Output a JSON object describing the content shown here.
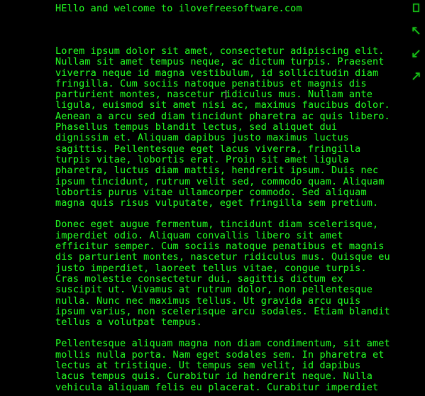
{
  "terminal": {
    "background_color": "#000000",
    "text_color": "#1fe01f",
    "greeting": "HEllo and welcome to ilovefreesoftware.com",
    "paragraphs": [
      {
        "id": "paragraph-1",
        "lines_before_caret": "Lorem ipsum dolor sit amet, consectetur adipiscing elit.\nNullam sit amet tempus neque, ac dictum turpis. Praesent\nviverra neque id magna vestibulum, id sollicitudin diam\nfringilla. Cum sociis natoque penatibus et magnis dis\nparturient montes, nascetur r",
        "lines_after_caret": "idiculus mus. Nullam ante\nligula, euismod sit amet nisi ac, maximus faucibus dolor.\nAenean a arcu sed diam tincidunt pharetra ac quis libero.\nPhasellus tempus blandit lectus, sed aliquet dui\ndignissim et. Aliquam dapibus justo maximus luctus\nsagittis. Pellentesque eget lacus viverra, fringilla\nturpis vitae, lobortis erat. Proin sit amet ligula\npharetra, luctus diam mattis, hendrerit ipsum. Duis nec\nipsum tincidunt, rutrum velit sed, commodo quam. Aliquam\nlobortis purus vitae ullamcorper commodo. Sed aliquam\nmagna quis risus vulputate, eget fringilla sem pretium."
      },
      {
        "id": "paragraph-2",
        "text": "Donec eget augue fermentum, tincidunt diam scelerisque,\nimperdiet odio. Aliquam convallis libero sit amet\nefficitur semper. Cum sociis natoque penatibus et magnis\ndis parturient montes, nascetur ridiculus mus. Quisque eu\njusto imperdiet, laoreet tellus vitae, congue turpis.\nCras molestie consectetur dui, sagittis dictum ex\nsuscipit ut. Vivamus at rutrum dolor, non pellentesque\nnulla. Nunc nec maximus tellus. Ut gravida arcu quis\nipsum varius, non scelerisque arcu sodales. Etiam blandit\ntellus a volutpat tempus."
      },
      {
        "id": "paragraph-3",
        "text": "Pellentesque aliquam magna non diam condimentum, sit amet\nmollis nulla porta. Nam eget sodales sem. In pharetra et\nlectus at tristique. Ut tempus sem velit, id dapibus\nlacus tempus quis. Curabitur id hendrerit neque. Nulla\nvehicula aliquam felis eu placerat. Curabitur imperdiet"
      }
    ]
  },
  "icon_rail": {
    "icons": [
      {
        "name": "window-icon",
        "label": "window"
      },
      {
        "name": "arrow-up-left-icon",
        "label": "arrow up left"
      },
      {
        "name": "arrow-down-left-icon",
        "label": "arrow down left"
      },
      {
        "name": "arrow-up-right-icon",
        "label": "arrow up right"
      }
    ]
  }
}
